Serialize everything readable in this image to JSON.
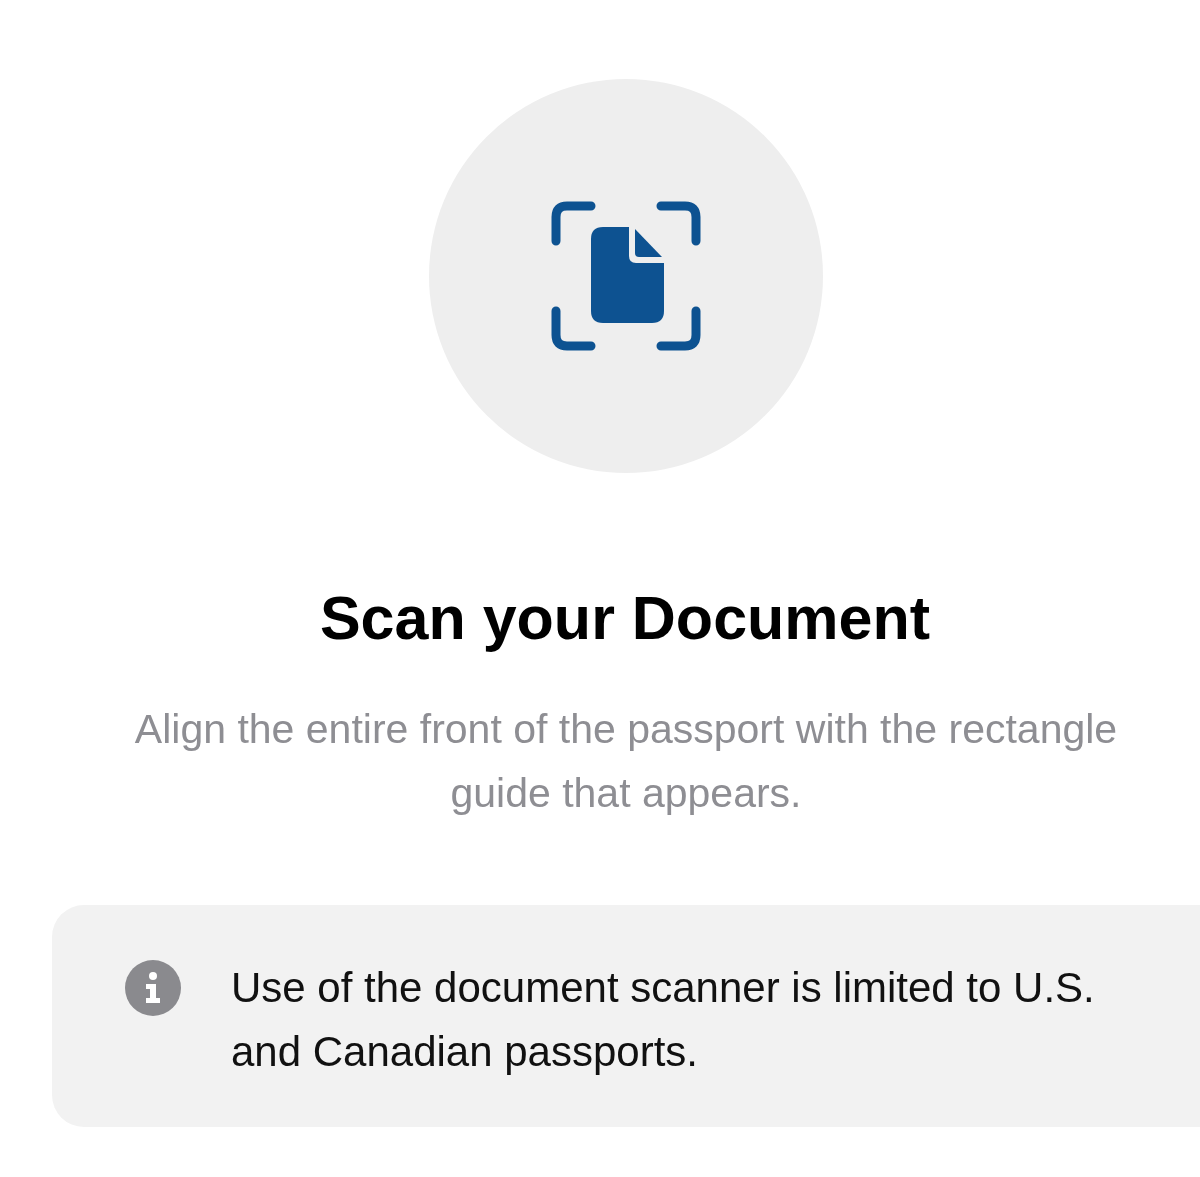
{
  "title": "Scan your Document",
  "instructions": "Align the entire front of the passport with the rectangle guide that appears.",
  "notice": {
    "text": "Use of the document scanner is limited to U.S. and Canadian passports."
  }
}
